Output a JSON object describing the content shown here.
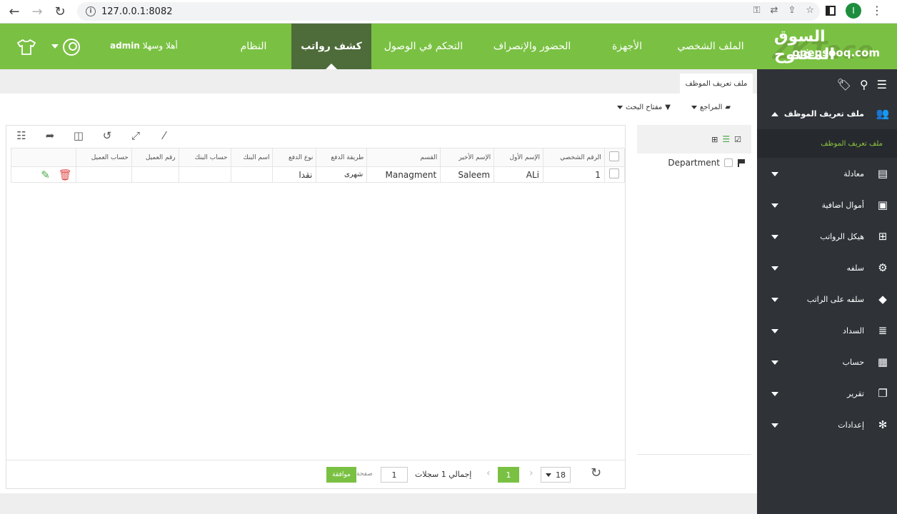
{
  "browser": {
    "url": "127.0.0.1:8082",
    "profile_initial": "I"
  },
  "header": {
    "nav": [
      {
        "label": "الملف الشخصي"
      },
      {
        "label": "الأجهزة"
      },
      {
        "label": "الحضور والإنصراف"
      },
      {
        "label": "التحكم في الوصول"
      },
      {
        "label": "كشف رواتب"
      },
      {
        "label": "النظام"
      }
    ],
    "active_nav": "كشف رواتب",
    "welcome": "أهلا وسهلا",
    "username": "admin",
    "logo_text": "ZKTeco",
    "watermark_ar": "السوق المفتوح",
    "watermark_en": "opensooq.com",
    "accent_color": "#7ac143",
    "active_color": "#4e6b3a"
  },
  "sidebar": {
    "items": [
      {
        "label": "ملف تعريف الموظف",
        "icon": "users-icon",
        "expanded": true
      },
      {
        "label": "معادلة",
        "icon": "formula-icon"
      },
      {
        "label": "أموال اضافية",
        "icon": "money-icon"
      },
      {
        "label": "هيكل الرواتب",
        "icon": "structure-icon"
      },
      {
        "label": "سلفه",
        "icon": "gear-icon"
      },
      {
        "label": "سلفه على الراتب",
        "icon": "tag-icon"
      },
      {
        "label": "السداد",
        "icon": "database-icon"
      },
      {
        "label": "حساب",
        "icon": "calculator-icon"
      },
      {
        "label": "تقرير",
        "icon": "report-icon"
      },
      {
        "label": "إعدادات",
        "icon": "settings-icon"
      }
    ],
    "subitem": "ملف تعريف الموظف"
  },
  "tab": {
    "label": "ملف تعريف الموظف"
  },
  "toolbar": {
    "references": "المراجع",
    "search_key": "مفتاح البحث"
  },
  "grid": {
    "columns": [
      "الرقم الشخصي",
      "الإسم الأول",
      "الإسم الأخير",
      "القسم",
      "طريقة الدفع",
      "نوع الدفع",
      "اسم البنك",
      "حساب البنك",
      "رقم العميل",
      "حساب العميل"
    ],
    "rows": [
      {
        "id": "1",
        "first": "ALi",
        "last": "Saleem",
        "dept": "Managment",
        "pay_method": "شهرى",
        "pay_type": "نقدا",
        "bank": "",
        "bank_acc": "",
        "client_no": "",
        "client_acc": ""
      }
    ]
  },
  "pager": {
    "page_size": "18",
    "current_page": "1",
    "total": "إجمالي 1 سجلات",
    "page_input": "1",
    "page_label": "صفحة",
    "go_label": "موافقة"
  },
  "tree": {
    "node": "Department"
  }
}
